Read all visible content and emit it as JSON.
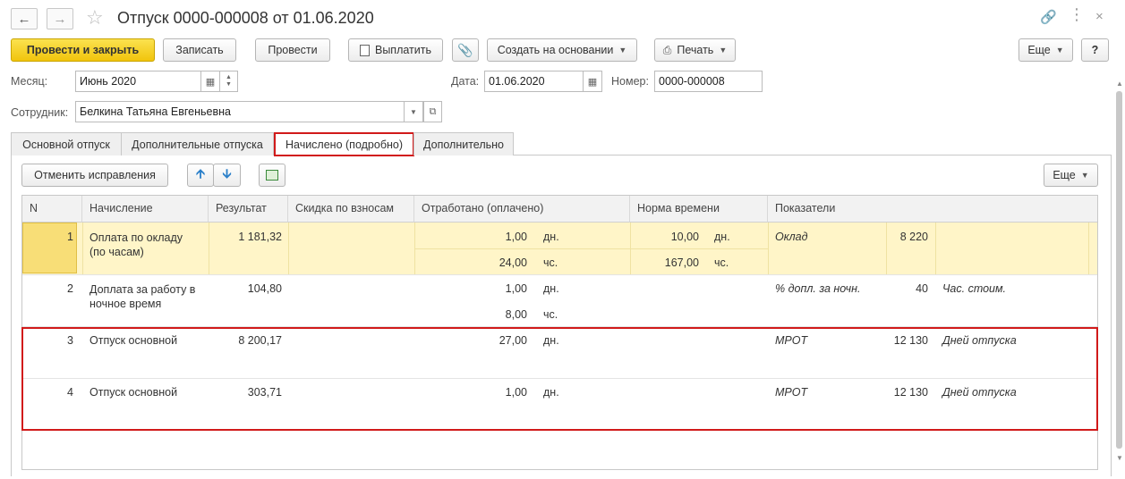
{
  "window": {
    "title": "Отпуск 0000-000008 от 01.06.2020",
    "back_icon": "arrow-left-icon",
    "forward_icon": "arrow-right-icon"
  },
  "toolbar": {
    "post_close": "Провести и закрыть",
    "save": "Записать",
    "post": "Провести",
    "pay": "Выплатить",
    "create_based": "Создать на основании",
    "print": "Печать",
    "more": "Еще",
    "help": "?"
  },
  "form": {
    "month_label": "Месяц:",
    "month_value": "Июнь 2020",
    "date_label": "Дата:",
    "date_value": "01.06.2020",
    "number_label": "Номер:",
    "number_value": "0000-000008",
    "employee_label": "Сотрудник:",
    "employee_value": "Белкина Татьяна Евгеньевна"
  },
  "tabs": [
    {
      "label": "Основной отпуск",
      "active": false
    },
    {
      "label": "Дополнительные отпуска",
      "active": false
    },
    {
      "label": "Начислено (подробно)",
      "active": true
    },
    {
      "label": "Дополнительно",
      "active": false
    }
  ],
  "panel": {
    "cancel_fixes": "Отменить исправления",
    "more": "Еще"
  },
  "table": {
    "columns": [
      "N",
      "Начисление",
      "Результат",
      "Скидка по взносам",
      "Отработано (оплачено)",
      "Норма времени",
      "Показатели"
    ],
    "rows": [
      {
        "n": "1",
        "name": "Оплата по окладу\n(по часам)",
        "result": "1 181,32",
        "worked1": "1,00",
        "unit1": "дн.",
        "worked2": "24,00",
        "unit2": "чс.",
        "norm1": "10,00",
        "nunit1": "дн.",
        "norm2": "167,00",
        "nunit2": "чс.",
        "ind_name": "Оклад",
        "ind_value": "8 220",
        "ind_name2": ""
      },
      {
        "n": "2",
        "name": "Доплата за работу в\nночное время",
        "result": "104,80",
        "worked1": "1,00",
        "unit1": "дн.",
        "worked2": "8,00",
        "unit2": "чс.",
        "norm1": "",
        "nunit1": "",
        "norm2": "",
        "nunit2": "",
        "ind_name": "% допл. за ночн.",
        "ind_value": "40",
        "ind_name2": "Час. стоим."
      },
      {
        "n": "3",
        "name": "Отпуск основной",
        "result": "8 200,17",
        "worked1": "27,00",
        "unit1": "дн.",
        "worked2": "",
        "unit2": "",
        "norm1": "",
        "nunit1": "",
        "norm2": "",
        "nunit2": "",
        "ind_name": "МРОТ",
        "ind_value": "12 130",
        "ind_name2": "Дней отпуска"
      },
      {
        "n": "4",
        "name": "Отпуск основной",
        "result": "303,71",
        "worked1": "1,00",
        "unit1": "дн.",
        "worked2": "",
        "unit2": "",
        "norm1": "",
        "nunit1": "",
        "norm2": "",
        "nunit2": "",
        "ind_name": "МРОТ",
        "ind_value": "12 130",
        "ind_name2": "Дней отпуска"
      }
    ]
  },
  "colors": {
    "accent_yellow": "#f5cf1d",
    "selected_row": "#fff5c8",
    "highlight_red": "#d11a1a"
  }
}
